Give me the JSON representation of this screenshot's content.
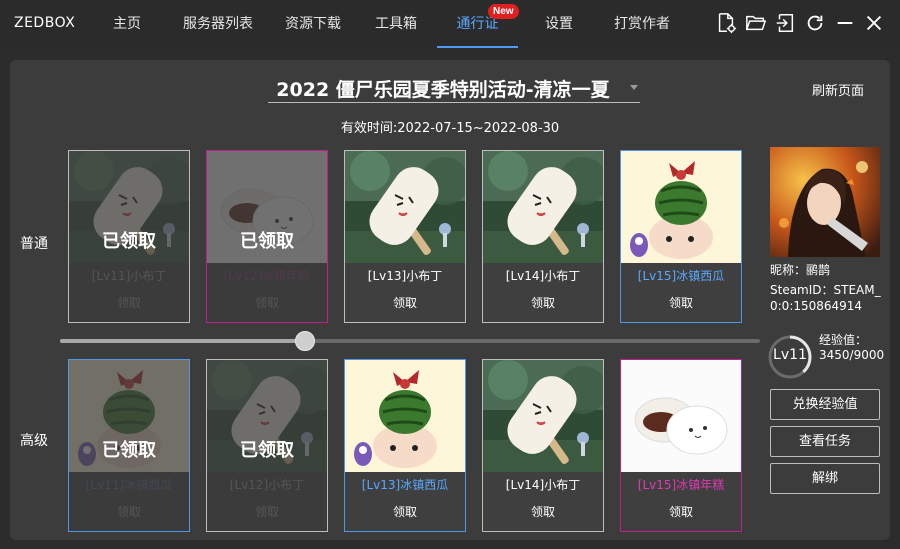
{
  "app": {
    "name": "ZEDBOX"
  },
  "nav": {
    "items": [
      {
        "label": "主页"
      },
      {
        "label": "服务器列表"
      },
      {
        "label": "资源下载"
      },
      {
        "label": "工具箱"
      },
      {
        "label": "通行证",
        "active": true
      },
      {
        "label": "设置"
      },
      {
        "label": "打赏作者"
      }
    ],
    "new_badge": "New"
  },
  "window_icons": [
    "file-settings-icon",
    "folder-open-icon",
    "login-icon",
    "refresh-icon",
    "minimize-icon",
    "close-icon"
  ],
  "event": {
    "title": "2022 僵尸乐园夏季特别活动-清凉一夏",
    "validity": "有效时间:2022-07-15~2022-08-30",
    "refresh_label": "刷新页面"
  },
  "rows": {
    "normal_label": "普通",
    "advanced_label": "高级"
  },
  "claimed_text": "已领取",
  "claim_label": "领取",
  "normal_cards": [
    {
      "name": "[Lv11]小布丁",
      "claimed": true,
      "art": "popsicle",
      "accent": "none"
    },
    {
      "name": "[Lv12]冰镇年糕",
      "claimed": true,
      "art": "mochi",
      "accent": "pink"
    },
    {
      "name": "[Lv13]小布丁",
      "claimed": false,
      "art": "popsicle",
      "accent": "none"
    },
    {
      "name": "[Lv14]小布丁",
      "claimed": false,
      "art": "popsicle",
      "accent": "none"
    },
    {
      "name": "[Lv15]冰镇西瓜",
      "claimed": false,
      "art": "watermelon",
      "accent": "blue"
    }
  ],
  "advanced_cards": [
    {
      "name": "[Lv11]冰镇西瓜",
      "claimed": true,
      "art": "watermelon",
      "accent": "blue"
    },
    {
      "name": "[Lv12]小布丁",
      "claimed": true,
      "art": "popsicle",
      "accent": "none"
    },
    {
      "name": "[Lv13]冰镇西瓜",
      "claimed": false,
      "art": "watermelon",
      "accent": "blue"
    },
    {
      "name": "[Lv14]小布丁",
      "claimed": false,
      "art": "popsicle",
      "accent": "none"
    },
    {
      "name": "[Lv15]冰镇年糕",
      "claimed": false,
      "art": "mochi",
      "accent": "pink"
    }
  ],
  "slider": {
    "value_fraction": 0.35
  },
  "user": {
    "nickname": "昵称：鹂鹊",
    "steam_id": "SteamID：STEAM_0:0:150864914",
    "level_label": "Lv11",
    "exp_text": "经验值：3450/9000",
    "exp_fraction": 0.383
  },
  "side_buttons": {
    "exchange": "兑换经验值",
    "tasks": "查看任务",
    "unbind": "解绑"
  },
  "colors": {
    "accent_blue": "#4f96e6",
    "accent_pink": "#c0208e",
    "badge_red": "#e02020"
  }
}
